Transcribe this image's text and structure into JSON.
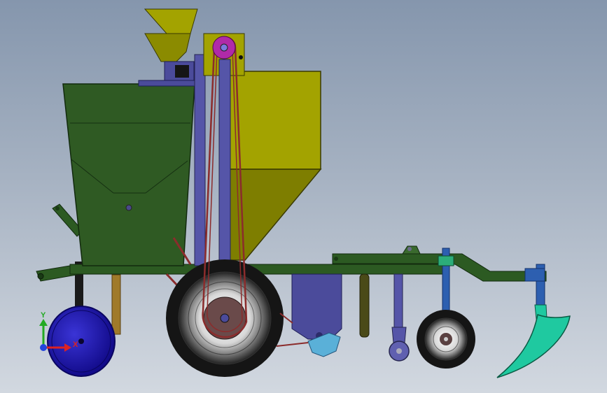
{
  "axis_triad": {
    "y_label": "Y",
    "x_label": "X",
    "y_color": "#22aa22",
    "x_color": "#dd2222",
    "z_color": "#2244dd"
  },
  "palette": {
    "frame_green": "#2c5a22",
    "hopper_yellow": "#a3a300",
    "chain_red": "#8b2c2c",
    "wheel_blue": "#1a12b8",
    "post_purple": "#5555a8",
    "plow_teal": "#1fc9a0",
    "sprocket_magenta": "#b02aa8"
  }
}
